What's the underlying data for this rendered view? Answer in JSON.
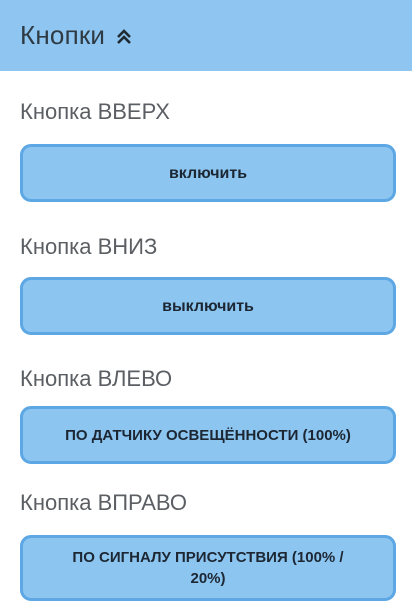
{
  "header": {
    "title": "Кнопки",
    "icon": "chevrons-up-icon"
  },
  "buttons": [
    {
      "label": "Кнопка ВВЕРХ",
      "action": "включить"
    },
    {
      "label": "Кнопка ВНИЗ",
      "action": "выключить"
    },
    {
      "label": "Кнопка ВЛЕВО",
      "action": "ПО ДАТЧИКУ ОСВЕЩЁННОСТИ (100%)"
    },
    {
      "label": "Кнопка ВПРАВО",
      "action": "ПО СИГНАЛУ ПРИСУТСТВИЯ (100% / 20%)"
    }
  ],
  "colors": {
    "header_bg": "#8fc6f1",
    "button_bg": "#8cc5f0",
    "button_border": "#5da7e4",
    "label_text": "#5b5f63"
  }
}
